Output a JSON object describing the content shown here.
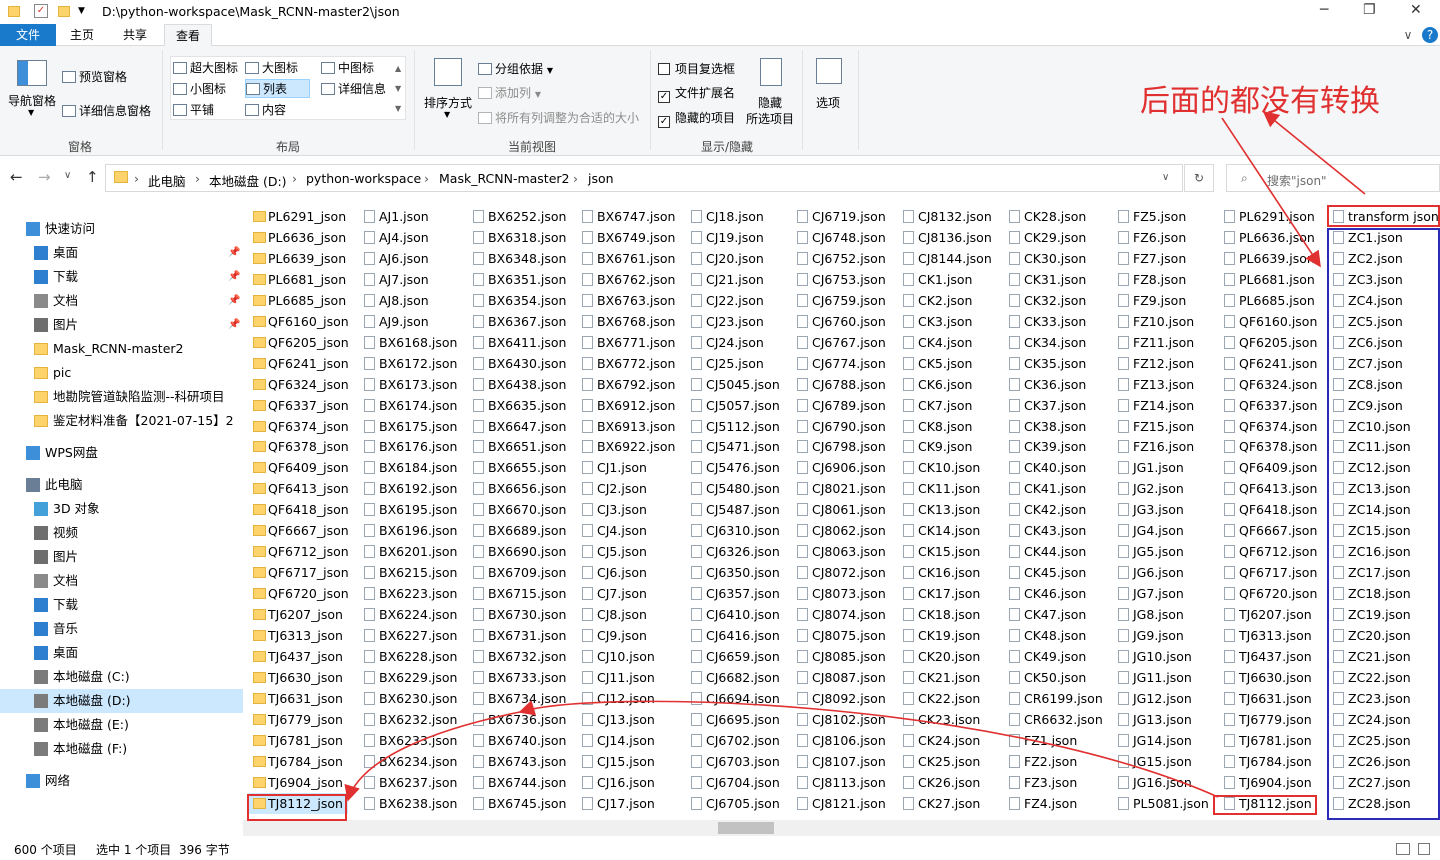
{
  "window": {
    "path": "D:\\python-workspace\\Mask_RCNN-master2\\json",
    "minimize": "─",
    "maximize": "❐",
    "close": "✕"
  },
  "tabs": {
    "file": "文件",
    "home": "主页",
    "share": "共享",
    "view": "查看",
    "expand": "∨",
    "help": "?"
  },
  "ribbon": {
    "nav_pane": "导航窗格",
    "preview_pane": "预览窗格",
    "details_pane": "详细信息窗格",
    "group_panes": "窗格",
    "layouts": [
      "超大图标",
      "大图标",
      "中图标",
      "小图标",
      "列表",
      "详细信息",
      "平铺",
      "内容"
    ],
    "group_layout": "布局",
    "sort_by": "排序方式",
    "group_by": "分组依据",
    "add_columns": "添加列",
    "size_all_columns": "将所有列调整为合适的大小",
    "group_current_view": "当前视图",
    "item_checkboxes": "项目复选框",
    "file_name_extensions": "文件扩展名",
    "hidden_items": "隐藏的项目",
    "hide_selected_line1": "隐藏",
    "hide_selected_line2": "所选项目",
    "group_show_hide": "显示/隐藏",
    "options": "选项",
    "checks": {
      "item_checkboxes": false,
      "file_name_extensions": true,
      "hidden_items": true
    }
  },
  "address": {
    "back": "←",
    "forward": "→",
    "recent": "∨",
    "up": "↑",
    "crumbs": [
      "此电脑",
      "本地磁盘 (D:)",
      "python-workspace",
      "Mask_RCNN-master2",
      "json"
    ],
    "sep": "›",
    "dropdown": "∨",
    "refresh": "↻",
    "search_placeholder": "搜索\"json\""
  },
  "sidebar": {
    "items": [
      {
        "label": "快速访问",
        "icon": "star-icon",
        "pinned": false
      },
      {
        "label": "桌面",
        "icon": "desktop-icon",
        "pinned": true
      },
      {
        "label": "下载",
        "icon": "download-icon",
        "pinned": true
      },
      {
        "label": "文档",
        "icon": "document-icon",
        "pinned": true
      },
      {
        "label": "图片",
        "icon": "pictures-icon",
        "pinned": true
      },
      {
        "label": "Mask_RCNN-master2",
        "icon": "folder-icon",
        "pinned": false
      },
      {
        "label": "pic",
        "icon": "folder-icon",
        "pinned": false
      },
      {
        "label": "地勘院管道缺陷监测--科研项目",
        "icon": "folder-icon",
        "pinned": false
      },
      {
        "label": "鉴定材料准备【2021-07-15】2",
        "icon": "folder-icon",
        "pinned": false
      },
      {
        "label": "WPS网盘",
        "icon": "cloud-icon",
        "pinned": false
      },
      {
        "label": "此电脑",
        "icon": "computer-icon",
        "pinned": false
      },
      {
        "label": "3D 对象",
        "icon": "3d-objects-icon",
        "pinned": false
      },
      {
        "label": "视频",
        "icon": "video-icon",
        "pinned": false
      },
      {
        "label": "图片",
        "icon": "pictures-icon",
        "pinned": false
      },
      {
        "label": "文档",
        "icon": "document-icon",
        "pinned": false
      },
      {
        "label": "下载",
        "icon": "download-icon",
        "pinned": false
      },
      {
        "label": "音乐",
        "icon": "music-icon",
        "pinned": false
      },
      {
        "label": "桌面",
        "icon": "desktop-icon",
        "pinned": false
      },
      {
        "label": "本地磁盘 (C:)",
        "icon": "drive-icon",
        "pinned": false
      },
      {
        "label": "本地磁盘 (D:)",
        "icon": "drive-icon",
        "pinned": false,
        "selected": true
      },
      {
        "label": "本地磁盘 (E:)",
        "icon": "drive-icon",
        "pinned": false
      },
      {
        "label": "本地磁盘 (F:)",
        "icon": "drive-icon",
        "pinned": false
      },
      {
        "label": "网络",
        "icon": "network-icon",
        "pinned": false
      }
    ],
    "pin_glyph": "📌"
  },
  "files": {
    "columns": [
      {
        "type": "folder",
        "names": [
          "PL6291_json",
          "PL6636_json",
          "PL6639_json",
          "PL6681_json",
          "PL6685_json",
          "QF6160_json",
          "QF6205_json",
          "QF6241_json",
          "QF6324_json",
          "QF6337_json",
          "QF6374_json",
          "QF6378_json",
          "QF6409_json",
          "QF6413_json",
          "QF6418_json",
          "QF6667_json",
          "QF6712_json",
          "QF6717_json",
          "QF6720_json",
          "TJ6207_json",
          "TJ6313_json",
          "TJ6437_json",
          "TJ6630_json",
          "TJ6631_json",
          "TJ6779_json",
          "TJ6781_json",
          "TJ6784_json",
          "TJ6904_json",
          "TJ8112_json"
        ]
      },
      {
        "type": "file",
        "names": [
          "AJ1.json",
          "AJ4.json",
          "AJ6.json",
          "AJ7.json",
          "AJ8.json",
          "AJ9.json",
          "BX6168.json",
          "BX6172.json",
          "BX6173.json",
          "BX6174.json",
          "BX6175.json",
          "BX6176.json",
          "BX6184.json",
          "BX6192.json",
          "BX6195.json",
          "BX6196.json",
          "BX6201.json",
          "BX6215.json",
          "BX6223.json",
          "BX6224.json",
          "BX6227.json",
          "BX6228.json",
          "BX6229.json",
          "BX6230.json",
          "BX6232.json",
          "BX6233.json",
          "BX6234.json",
          "BX6237.json",
          "BX6238.json"
        ]
      },
      {
        "type": "file",
        "names": [
          "BX6252.json",
          "BX6318.json",
          "BX6348.json",
          "BX6351.json",
          "BX6354.json",
          "BX6367.json",
          "BX6411.json",
          "BX6430.json",
          "BX6438.json",
          "BX6635.json",
          "BX6647.json",
          "BX6651.json",
          "BX6655.json",
          "BX6656.json",
          "BX6670.json",
          "BX6689.json",
          "BX6690.json",
          "BX6709.json",
          "BX6715.json",
          "BX6730.json",
          "BX6731.json",
          "BX6732.json",
          "BX6733.json",
          "BX6734.json",
          "BX6736.json",
          "BX6740.json",
          "BX6743.json",
          "BX6744.json",
          "BX6745.json"
        ]
      },
      {
        "type": "file",
        "names": [
          "BX6747.json",
          "BX6749.json",
          "BX6761.json",
          "BX6762.json",
          "BX6763.json",
          "BX6768.json",
          "BX6771.json",
          "BX6772.json",
          "BX6792.json",
          "BX6912.json",
          "BX6913.json",
          "BX6922.json",
          "CJ1.json",
          "CJ2.json",
          "CJ3.json",
          "CJ4.json",
          "CJ5.json",
          "CJ6.json",
          "CJ7.json",
          "CJ8.json",
          "CJ9.json",
          "CJ10.json",
          "CJ11.json",
          "CJ12.json",
          "CJ13.json",
          "CJ14.json",
          "CJ15.json",
          "CJ16.json",
          "CJ17.json"
        ]
      },
      {
        "type": "file",
        "names": [
          "CJ18.json",
          "CJ19.json",
          "CJ20.json",
          "CJ21.json",
          "CJ22.json",
          "CJ23.json",
          "CJ24.json",
          "CJ25.json",
          "CJ5045.json",
          "CJ5057.json",
          "CJ5112.json",
          "CJ5471.json",
          "CJ5476.json",
          "CJ5480.json",
          "CJ5487.json",
          "CJ6310.json",
          "CJ6326.json",
          "CJ6350.json",
          "CJ6357.json",
          "CJ6410.json",
          "CJ6416.json",
          "CJ6659.json",
          "CJ6682.json",
          "CJ6694.json",
          "CJ6695.json",
          "CJ6702.json",
          "CJ6703.json",
          "CJ6704.json",
          "CJ6705.json"
        ]
      },
      {
        "type": "file",
        "names": [
          "CJ6719.json",
          "CJ6748.json",
          "CJ6752.json",
          "CJ6753.json",
          "CJ6759.json",
          "CJ6760.json",
          "CJ6767.json",
          "CJ6774.json",
          "CJ6788.json",
          "CJ6789.json",
          "CJ6790.json",
          "CJ6798.json",
          "CJ6906.json",
          "CJ8021.json",
          "CJ8061.json",
          "CJ8062.json",
          "CJ8063.json",
          "CJ8072.json",
          "CJ8073.json",
          "CJ8074.json",
          "CJ8075.json",
          "CJ8085.json",
          "CJ8087.json",
          "CJ8092.json",
          "CJ8102.json",
          "CJ8106.json",
          "CJ8107.json",
          "CJ8113.json",
          "CJ8121.json"
        ]
      },
      {
        "type": "file",
        "names": [
          "CJ8132.json",
          "CJ8136.json",
          "CJ8144.json",
          "CK1.json",
          "CK2.json",
          "CK3.json",
          "CK4.json",
          "CK5.json",
          "CK6.json",
          "CK7.json",
          "CK8.json",
          "CK9.json",
          "CK10.json",
          "CK11.json",
          "CK13.json",
          "CK14.json",
          "CK15.json",
          "CK16.json",
          "CK17.json",
          "CK18.json",
          "CK19.json",
          "CK20.json",
          "CK21.json",
          "CK22.json",
          "CK23.json",
          "CK24.json",
          "CK25.json",
          "CK26.json",
          "CK27.json"
        ]
      },
      {
        "type": "file",
        "names": [
          "CK28.json",
          "CK29.json",
          "CK30.json",
          "CK31.json",
          "CK32.json",
          "CK33.json",
          "CK34.json",
          "CK35.json",
          "CK36.json",
          "CK37.json",
          "CK38.json",
          "CK39.json",
          "CK40.json",
          "CK41.json",
          "CK42.json",
          "CK43.json",
          "CK44.json",
          "CK45.json",
          "CK46.json",
          "CK47.json",
          "CK48.json",
          "CK49.json",
          "CK50.json",
          "CR6199.json",
          "CR6632.json",
          "FZ1.json",
          "FZ2.json",
          "FZ3.json",
          "FZ4.json"
        ]
      },
      {
        "type": "file",
        "names": [
          "FZ5.json",
          "FZ6.json",
          "FZ7.json",
          "FZ8.json",
          "FZ9.json",
          "FZ10.json",
          "FZ11.json",
          "FZ12.json",
          "FZ13.json",
          "FZ14.json",
          "FZ15.json",
          "FZ16.json",
          "JG1.json",
          "JG2.json",
          "JG3.json",
          "JG4.json",
          "JG5.json",
          "JG6.json",
          "JG7.json",
          "JG8.json",
          "JG9.json",
          "JG10.json",
          "JG11.json",
          "JG12.json",
          "JG13.json",
          "JG14.json",
          "JG15.json",
          "JG16.json",
          "PL5081.json"
        ]
      },
      {
        "type": "file",
        "names": [
          "PL6291.json",
          "PL6636.json",
          "PL6639.json",
          "PL6681.json",
          "PL6685.json",
          "QF6160.json",
          "QF6205.json",
          "QF6241.json",
          "QF6324.json",
          "QF6337.json",
          "QF6374.json",
          "QF6378.json",
          "QF6409.json",
          "QF6413.json",
          "QF6418.json",
          "QF6667.json",
          "QF6712.json",
          "QF6717.json",
          "QF6720.json",
          "TJ6207.json",
          "TJ6313.json",
          "TJ6437.json",
          "TJ6630.json",
          "TJ6631.json",
          "TJ6779.json",
          "TJ6781.json",
          "TJ6784.json",
          "TJ6904.json",
          "TJ8112.json"
        ]
      },
      {
        "type": "file",
        "names": [
          "transform json.py",
          "ZC1.json",
          "ZC2.json",
          "ZC3.json",
          "ZC4.json",
          "ZC5.json",
          "ZC6.json",
          "ZC7.json",
          "ZC8.json",
          "ZC9.json",
          "ZC10.json",
          "ZC11.json",
          "ZC12.json",
          "ZC13.json",
          "ZC14.json",
          "ZC15.json",
          "ZC16.json",
          "ZC17.json",
          "ZC18.json",
          "ZC19.json",
          "ZC20.json",
          "ZC21.json",
          "ZC22.json",
          "ZC23.json",
          "ZC24.json",
          "ZC25.json",
          "ZC26.json",
          "ZC27.json",
          "ZC28.json"
        ]
      }
    ],
    "selected": {
      "column": 0,
      "row": 28
    }
  },
  "status": {
    "count": "600 个项目",
    "selection": "选中 1 个项目",
    "size": "396 字节"
  },
  "annotation": {
    "text": "后面的都没有转换",
    "color": "#e03030",
    "box_color": "#2b2bb8"
  }
}
